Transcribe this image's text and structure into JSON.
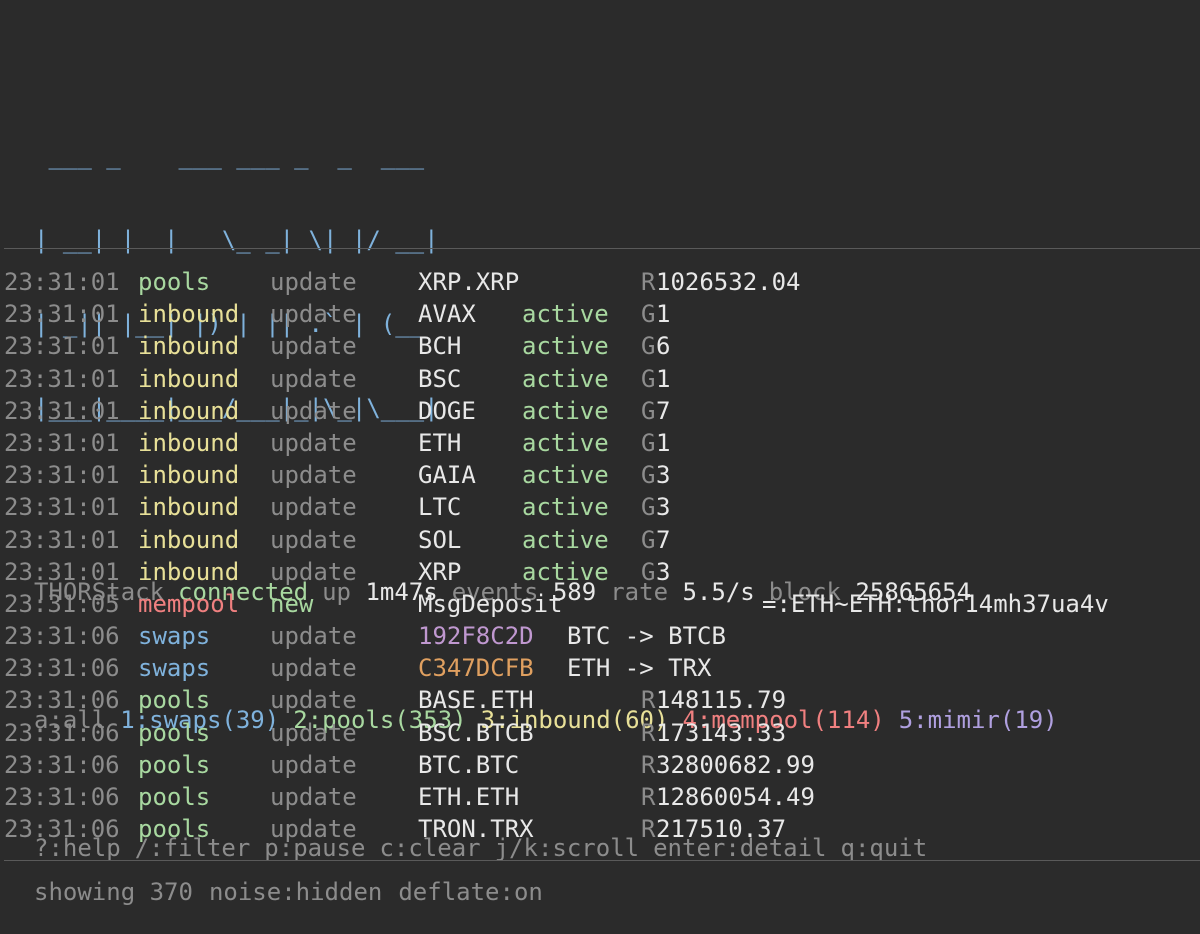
{
  "logo": [
    " ___ _    ___ ___ _  _  ___ ",
    "| __| |  |   \\_ _| \\| |/ __|",
    "| _|| |__| |) | || .` | (__ ",
    "|___|____|___/___|_|\\_|\\___|"
  ],
  "status": {
    "app": "THORStack",
    "connection": "connected",
    "up_label": "up",
    "up_value": "1m47s",
    "events_label": "events",
    "events_value": "589",
    "rate_label": "rate",
    "rate_value": "5.5/s",
    "block_label": "block",
    "block_value": "25865654"
  },
  "filters": {
    "all": "a:all",
    "swaps": "1:swaps(39)",
    "pools": "2:pools(353)",
    "inbound": "3:inbound(60)",
    "mempool": "4:mempool(114)",
    "mimir": "5:mimir(19)"
  },
  "keys": {
    "help": "?:help",
    "filter": "/:filter",
    "pause": "p:pause",
    "clear": "c:clear",
    "scroll": "j/k:scroll",
    "detail": "enter:detail",
    "quit": "q:quit"
  },
  "rows": [
    {
      "time": "23:31:01",
      "src": "pools",
      "act": "update",
      "key": "XRP.XRP",
      "pre": "R",
      "val": "1026532.04"
    },
    {
      "time": "23:31:01",
      "src": "inbound",
      "act": "update",
      "key": "AVAX",
      "st": "active",
      "pre": "G",
      "val": "1"
    },
    {
      "time": "23:31:01",
      "src": "inbound",
      "act": "update",
      "key": "BCH",
      "st": "active",
      "pre": "G",
      "val": "6"
    },
    {
      "time": "23:31:01",
      "src": "inbound",
      "act": "update",
      "key": "BSC",
      "st": "active",
      "pre": "G",
      "val": "1"
    },
    {
      "time": "23:31:01",
      "src": "inbound",
      "act": "update",
      "key": "DOGE",
      "st": "active",
      "pre": "G",
      "val": "7"
    },
    {
      "time": "23:31:01",
      "src": "inbound",
      "act": "update",
      "key": "ETH",
      "st": "active",
      "pre": "G",
      "val": "1"
    },
    {
      "time": "23:31:01",
      "src": "inbound",
      "act": "update",
      "key": "GAIA",
      "st": "active",
      "pre": "G",
      "val": "3"
    },
    {
      "time": "23:31:01",
      "src": "inbound",
      "act": "update",
      "key": "LTC",
      "st": "active",
      "pre": "G",
      "val": "3"
    },
    {
      "time": "23:31:01",
      "src": "inbound",
      "act": "update",
      "key": "SOL",
      "st": "active",
      "pre": "G",
      "val": "7"
    },
    {
      "time": "23:31:01",
      "src": "inbound",
      "act": "update",
      "key": "XRP",
      "st": "active",
      "pre": "G",
      "val": "3"
    },
    {
      "time": "23:31:05",
      "src": "mempool",
      "act": "new",
      "key": "MsgDeposit",
      "memo": "=:ETH~ETH:thor14mh37ua4v"
    },
    {
      "time": "23:31:06",
      "src": "swaps",
      "act": "update",
      "key": "192F8C2D",
      "keycolor": "#c098d0",
      "desc": "BTC -> BTCB"
    },
    {
      "time": "23:31:06",
      "src": "swaps",
      "act": "update",
      "key": "C347DCFB",
      "keycolor": "#e0a060",
      "desc": "ETH -> TRX"
    },
    {
      "time": "23:31:06",
      "src": "pools",
      "act": "update",
      "key": "BASE.ETH",
      "pre": "R",
      "val": "148115.79"
    },
    {
      "time": "23:31:06",
      "src": "pools",
      "act": "update",
      "key": "BSC.BTCB",
      "pre": "R",
      "val": "173143.33"
    },
    {
      "time": "23:31:06",
      "src": "pools",
      "act": "update",
      "key": "BTC.BTC",
      "pre": "R",
      "val": "32800682.99"
    },
    {
      "time": "23:31:06",
      "src": "pools",
      "act": "update",
      "key": "ETH.ETH",
      "pre": "R",
      "val": "12860054.49"
    },
    {
      "time": "23:31:06",
      "src": "pools",
      "act": "update",
      "key": "TRON.TRX",
      "pre": "R",
      "val": "217510.37"
    }
  ],
  "colors": {
    "pools": "#a8d8a0",
    "inbound": "#e8e098",
    "mempool": "#f08080",
    "swaps": "#7fb2dc",
    "update": "#8c8c8c",
    "new": "#a8d8a0",
    "active": "#a8d8a0"
  },
  "footer": {
    "showing": "showing 370",
    "noise": "noise:hidden",
    "deflate": "deflate:on"
  }
}
